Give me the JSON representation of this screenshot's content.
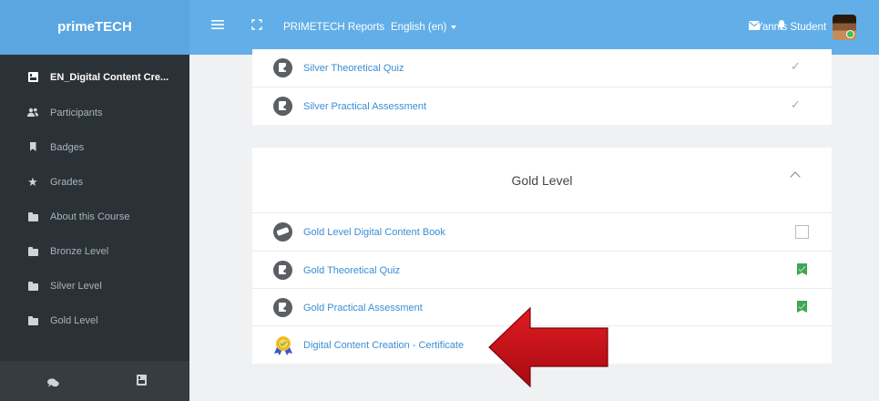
{
  "topbar": {
    "brand": "primeTECH",
    "reports_label": "PRIMETECH Reports",
    "language_label": "English (en)",
    "user_name": "Yannis Student",
    "icons": [
      "hamburger-icon",
      "fullscreen-icon",
      "mail-icon",
      "bell-icon"
    ]
  },
  "sidebar": {
    "items": [
      {
        "label": "EN_Digital Content Cre...",
        "icon": "course-icon"
      },
      {
        "label": "Participants",
        "icon": "users-icon"
      },
      {
        "label": "Badges",
        "icon": "bookmark-icon"
      },
      {
        "label": "Grades",
        "icon": "star-icon"
      },
      {
        "label": "About this Course",
        "icon": "folder-icon"
      },
      {
        "label": "Bronze Level",
        "icon": "folder-icon"
      },
      {
        "label": "Silver Level",
        "icon": "folder-icon"
      },
      {
        "label": "Gold Level",
        "icon": "folder-icon"
      }
    ]
  },
  "silver_card": {
    "activities": [
      {
        "label": "Silver Theoretical Quiz",
        "status": "check"
      },
      {
        "label": "Silver Practical Assessment",
        "status": "check"
      }
    ]
  },
  "gold_card": {
    "title": "Gold Level",
    "activities": [
      {
        "label": "Gold Level Digital Content Book",
        "status": "empty-checkbox"
      },
      {
        "label": "Gold Theoretical Quiz",
        "status": "complete"
      },
      {
        "label": "Gold Practical Assessment",
        "status": "complete"
      },
      {
        "label": "Digital Content Creation - Certificate",
        "status": "none"
      }
    ]
  },
  "colors": {
    "topbar": "#62aee8",
    "sidebar": "#2b3237",
    "link": "#3a8ed4",
    "complete_flag": "#3fa652",
    "annotation_arrow": "#c4101b"
  }
}
